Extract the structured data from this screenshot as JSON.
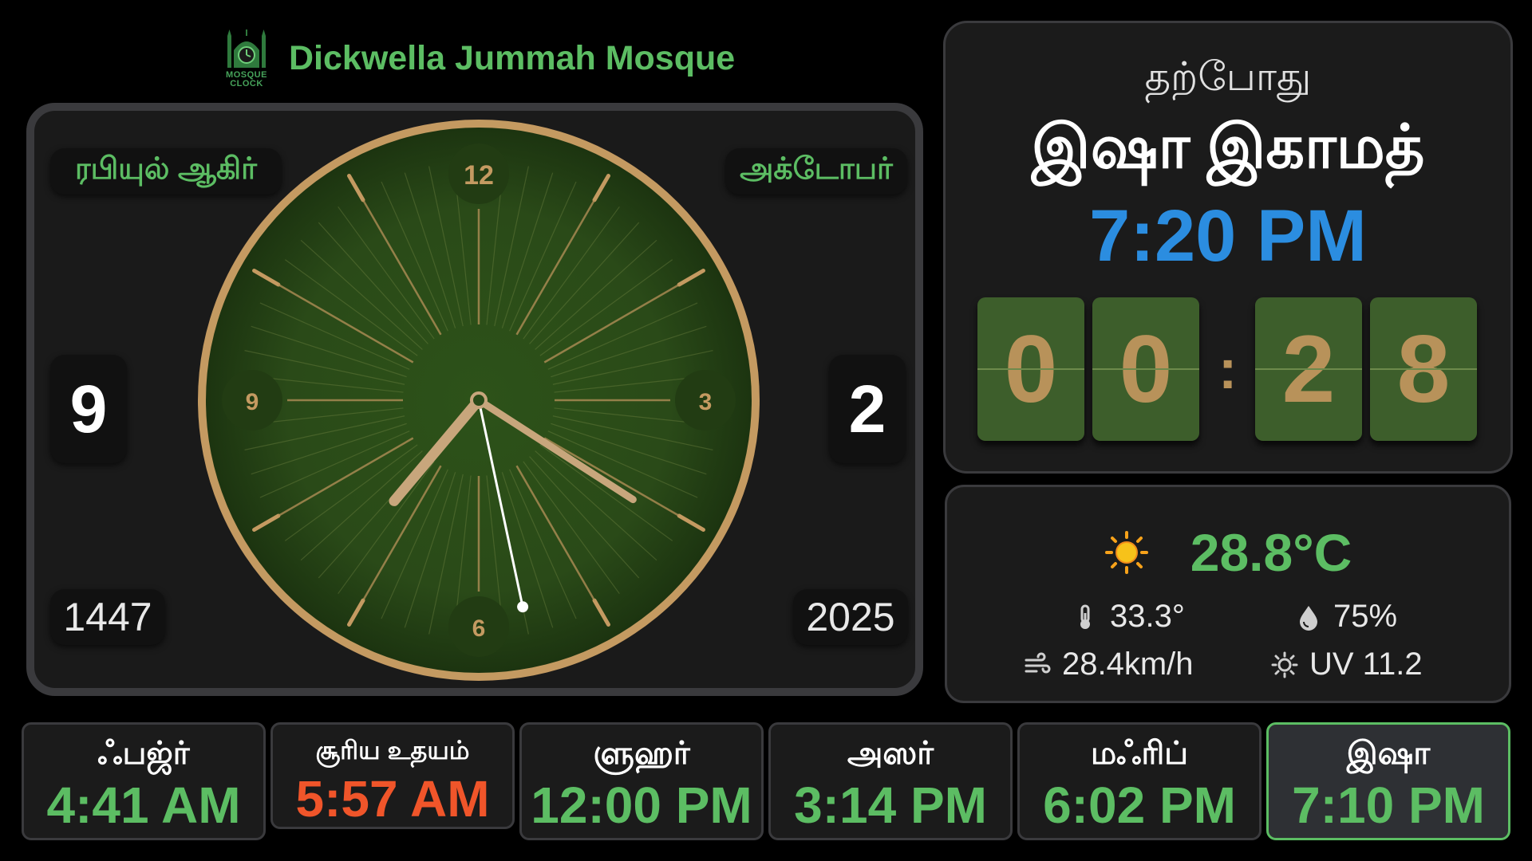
{
  "header": {
    "logo_text_line1": "MOSQUE",
    "logo_text_line2": "CLOCK",
    "mosque_name": "Dickwella Jummah Mosque"
  },
  "calendar": {
    "hijri_month": "ரபியுல் ஆகிர்",
    "hijri_day": "9",
    "hijri_year": "1447",
    "greg_month": "அக்டோபர்",
    "greg_day": "2",
    "greg_year": "2025"
  },
  "clock": {
    "numerals": {
      "top": "12",
      "right": "3",
      "bottom": "6",
      "left": "9"
    },
    "time": {
      "hour": 7,
      "minute": 20,
      "second": 28
    }
  },
  "current": {
    "label": "தற்போது",
    "event_name": "இஷா இகாமத்",
    "event_time": "7:20 PM",
    "countdown_digits": [
      "0",
      "0",
      "2",
      "8"
    ],
    "countdown_separator": ":"
  },
  "weather": {
    "icon": "sun-icon",
    "temperature": "28.8°C",
    "feels_like": "33.3°",
    "humidity": "75%",
    "wind": "28.4km/h",
    "uv": "UV 11.2"
  },
  "prayers": [
    {
      "name": "ஃபஜ்ர்",
      "time": "4:41 AM"
    },
    {
      "name": "சூரிய உதயம்",
      "time": "5:57 AM"
    },
    {
      "name": "ளுஹர்",
      "time": "12:00 PM"
    },
    {
      "name": "அஸர்",
      "time": "3:14 PM"
    },
    {
      "name": "மஃரிப்",
      "time": "6:02 PM"
    },
    {
      "name": "இஷா",
      "time": "7:10 PM",
      "active": true
    }
  ],
  "colors": {
    "accent_green": "#5cbd63",
    "accent_blue": "#2b8de0",
    "sunrise_orange": "#f0552a",
    "clock_gold": "#c49a61",
    "clock_face": "#2a4a18"
  }
}
